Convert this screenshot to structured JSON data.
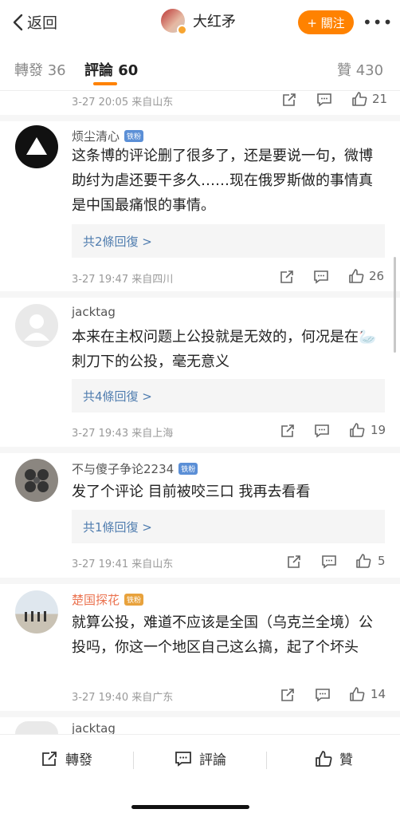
{
  "header": {
    "back_label": "返回",
    "author_name": "大红矛",
    "follow_label": "+ 關注",
    "more_label": "•••",
    "accent_color": "#ff8200"
  },
  "tabs": [
    {
      "label": "轉發",
      "count": "36"
    },
    {
      "label": "評論",
      "count": "60"
    },
    {
      "label": "贊",
      "count": "430"
    }
  ],
  "partial_top": {
    "time": "3-27 20:05",
    "location": "来自山东",
    "likes": "21"
  },
  "comments": [
    {
      "user": "烦尘清心",
      "badge": "铁粉",
      "text": "这条博的评论删了很多了，还是要说一句，微博助纣为虐还要干多久……现在俄罗斯做的事情真是中国最痛恨的事情。",
      "replies": "共2條回復 >",
      "time": "3-27 19:47",
      "location": "来自四川",
      "likes": "26"
    },
    {
      "user": "jacktag",
      "badge": "",
      "text": "本来在主权问题上公投就是无效的，何况是在🦢 刺刀下的公投，毫无意义",
      "replies": "共4條回復 >",
      "time": "3-27 19:43",
      "location": "来自上海",
      "likes": "19"
    },
    {
      "user": "不与傻子争论2234",
      "badge": "铁粉",
      "text": "发了个评论 目前被咬三口 我再去看看",
      "replies": "共1條回復 >",
      "time": "3-27 19:41",
      "location": "来自山东",
      "likes": "5"
    },
    {
      "user": "楚国探花",
      "badge": "铁粉",
      "text": "就算公投，难道不应该是全国（乌克兰全境）公投吗，你这一个地区自己这么搞，起了个坏头",
      "replies": "",
      "time": "3-27 19:40",
      "location": "来自广东",
      "likes": "14"
    },
    {
      "user": "jacktag",
      "badge": "",
      "text": "",
      "replies": "",
      "time": "",
      "location": "",
      "likes": ""
    }
  ],
  "bottom_bar": {
    "repost_label": "轉發",
    "comment_label": "評論",
    "like_label": "贊"
  }
}
